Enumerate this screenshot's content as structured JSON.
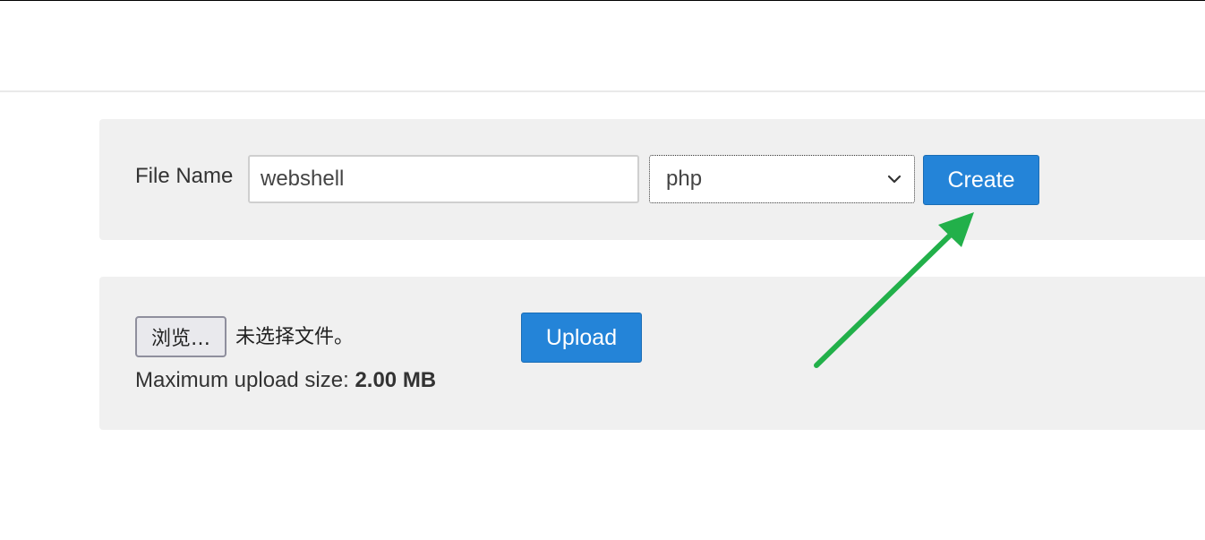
{
  "create_form": {
    "label": "File Name",
    "filename_value": "webshell",
    "extension_selected": "php",
    "create_label": "Create"
  },
  "upload_form": {
    "browse_label": "浏览…",
    "file_status": "未选择文件。",
    "upload_label": "Upload",
    "max_size_label": "Maximum upload size:",
    "max_size_value": "2.00 MB"
  },
  "icons": {
    "select_chevron": "chevron-down-icon",
    "annotation_arrow": "arrow-icon"
  },
  "colors": {
    "button_bg": "#2484d8",
    "panel_bg": "#f0f0f0",
    "annotation_arrow": "#22b04a"
  }
}
